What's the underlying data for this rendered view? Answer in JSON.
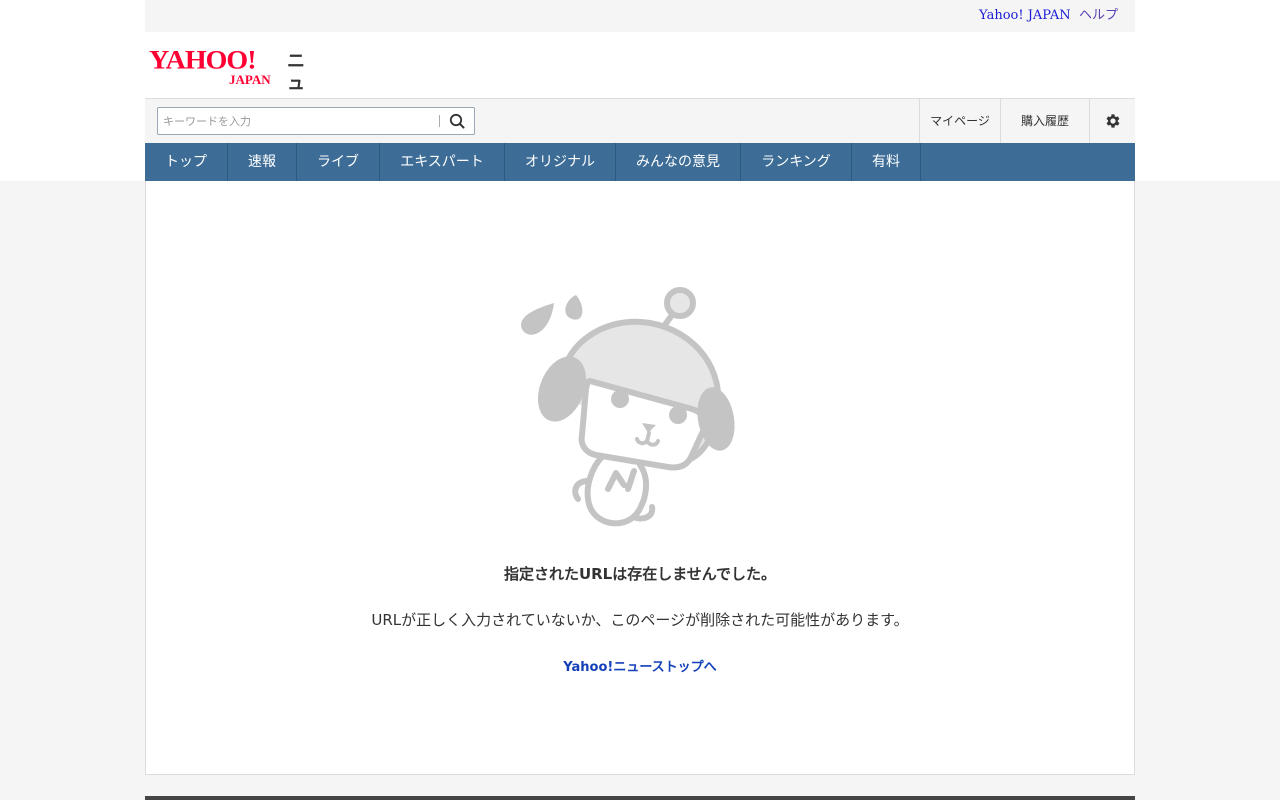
{
  "utility": {
    "yahoo_japan": "Yahoo! JAPAN",
    "help": "ヘルプ"
  },
  "logo": {
    "yahoo": "YAHOO!",
    "japan": "JAPAN",
    "service": "ニュース"
  },
  "search": {
    "placeholder": "キーワードを入力",
    "value": ""
  },
  "header_links": {
    "mypage": "マイページ",
    "history": "購入履歴"
  },
  "nav": {
    "items": [
      {
        "label": "トップ"
      },
      {
        "label": "速報"
      },
      {
        "label": "ライブ"
      },
      {
        "label": "エキスパート"
      },
      {
        "label": "オリジナル"
      },
      {
        "label": "みんなの意見"
      },
      {
        "label": "ランキング"
      },
      {
        "label": "有料"
      }
    ]
  },
  "error": {
    "title": "指定されたURLは存在しませんでした。",
    "description": "URLが正しく入力されていないか、このページが削除された可能性があります。",
    "link": "Yahoo!ニューストップへ"
  },
  "colors": {
    "brand_red": "#ff0033",
    "nav_bg": "#3d6d97",
    "link_blue": "#1440b8",
    "mascot_gray": "#c4c4c4"
  },
  "icons": [
    "search-icon",
    "gear-icon",
    "mascot-illustration"
  ]
}
